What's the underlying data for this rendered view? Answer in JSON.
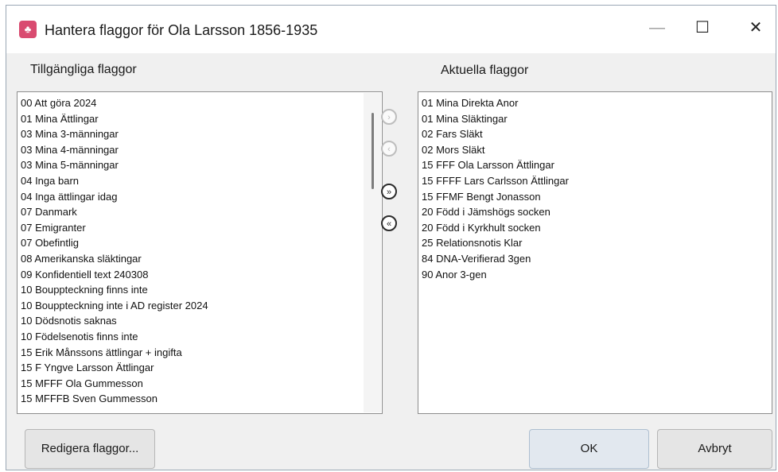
{
  "window": {
    "title": "Hantera flaggor för Ola Larsson 1856-1935",
    "icon": "family-tree-icon",
    "controls": {
      "minimize": "—",
      "maximize": "☐",
      "close": "✕"
    }
  },
  "available": {
    "label": "Tillgängliga flaggor",
    "items": [
      "00 Att göra 2024",
      "01 Mina Ättlingar",
      "03 Mina 3-männingar",
      "03 Mina 4-männingar",
      "03 Mina 5-männingar",
      "04 Inga barn",
      "04 Inga ättlingar idag",
      "07 Danmark",
      "07 Emigranter",
      "07 Obefintlig",
      "08 Amerikanska släktingar",
      "09 Konfidentiell text 240308",
      "10 Bouppteckning finns inte",
      "10 Bouppteckning inte i AD register 2024",
      "10 Dödsnotis saknas",
      "10 Födelsenotis finns inte",
      "15 Erik Månssons ättlingar + ingifta",
      "15 F Yngve Larsson Ättlingar",
      "15 MFFF Ola Gummesson",
      "15 MFFFB Sven Gummesson"
    ]
  },
  "current": {
    "label": "Aktuella flaggor",
    "items": [
      "01 Mina Direkta Anor",
      "01 Mina Släktingar",
      "02 Fars Släkt",
      "02 Mors Släkt",
      "15 FFF Ola Larsson Ättlingar",
      "15 FFFF Lars Carlsson Ättlingar",
      "15 FFMF Bengt Jonasson",
      "20 Född i Jämshögs socken",
      "20 Född i Kyrkhult socken",
      "25 Relationsnotis Klar",
      "84 DNA-Verifierad 3gen",
      "90 Anor 3-gen"
    ]
  },
  "transfer": {
    "add_one": "›",
    "remove_one": "‹",
    "add_all": "»",
    "remove_all": "«"
  },
  "buttons": {
    "edit": "Redigera flaggor...",
    "ok": "OK",
    "cancel": "Avbryt"
  }
}
